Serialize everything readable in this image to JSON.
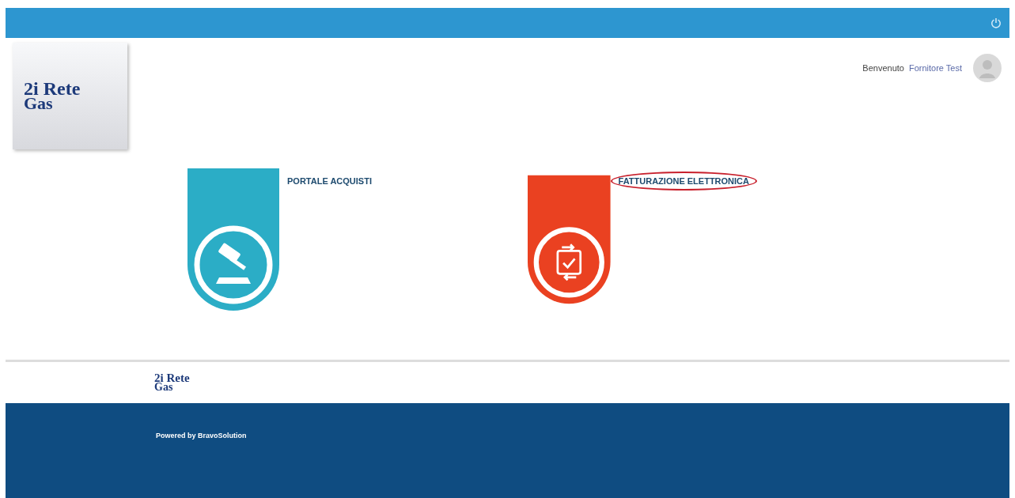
{
  "header": {
    "logo": {
      "top": "2i Rete",
      "bottom": "Gas"
    },
    "user": {
      "greeting": "Benvenuto",
      "name": "Fornitore Test"
    }
  },
  "tiles": [
    {
      "title": "PORTALE ACQUISTI",
      "color": "#2badc6",
      "kind": "gavel",
      "highlighted": false
    },
    {
      "title": "FATTURAZIONE ELETTRONICA",
      "color": "#ea4121",
      "kind": "exchange",
      "highlighted": true
    }
  ],
  "footer": {
    "logo": {
      "top": "2i Rete",
      "bottom": "Gas"
    },
    "powered_by": "Powered by BravoSolution"
  }
}
